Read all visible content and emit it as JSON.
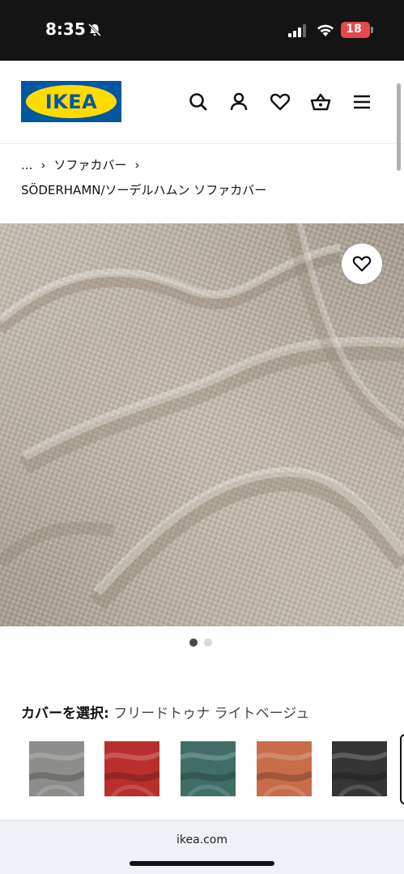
{
  "status_bar": {
    "time": "8:35",
    "battery_level": "18",
    "icons": [
      "bell-slash-icon",
      "cellular-signal-icon",
      "wifi-icon",
      "battery-icon"
    ],
    "battery_color": "#e5484d"
  },
  "header": {
    "logo_text": "IKEA",
    "logo_colors": {
      "blue": "#0058a3",
      "yellow": "#ffdb00"
    },
    "icons": [
      "search-icon",
      "account-icon",
      "heart-icon",
      "basket-icon",
      "hamburger-menu-icon"
    ]
  },
  "breadcrumb": {
    "items": [
      "...",
      "ソファカバー"
    ],
    "separator": "›"
  },
  "product": {
    "title": "SÖDERHAMN/ソーデルハムン ソファカバー",
    "image_count": 2,
    "active_image_index": 0
  },
  "cover": {
    "label": "カバーを選択:",
    "selected": "フリードトゥナ ライトベージュ",
    "swatches": [
      {
        "name": "gray",
        "color": "#8d8d8b"
      },
      {
        "name": "red",
        "color": "#b8302d"
      },
      {
        "name": "teal",
        "color": "#3f6e67"
      },
      {
        "name": "orange",
        "color": "#c96c4a"
      },
      {
        "name": "black",
        "color": "#353535"
      }
    ]
  },
  "browser": {
    "url": "ikea.com"
  }
}
